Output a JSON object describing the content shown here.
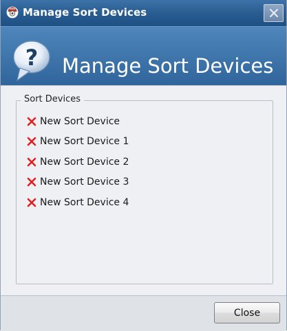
{
  "window": {
    "title": "Manage Sort Devices",
    "banner_title": "Manage Sort Devices"
  },
  "group": {
    "legend": "Sort Devices",
    "items": [
      {
        "label": "New Sort Device",
        "icon": "delete-x-icon"
      },
      {
        "label": "New Sort Device 1",
        "icon": "delete-x-icon"
      },
      {
        "label": "New Sort Device 2",
        "icon": "delete-x-icon"
      },
      {
        "label": "New Sort Device 3",
        "icon": "delete-x-icon"
      },
      {
        "label": "New Sort Device 4",
        "icon": "delete-x-icon"
      }
    ]
  },
  "footer": {
    "close_label": "Close"
  },
  "colors": {
    "titlebar": "#2b5f93",
    "banner": "#3f76ac",
    "delete_x": "#e02020",
    "content_bg": "#eef0f3"
  }
}
